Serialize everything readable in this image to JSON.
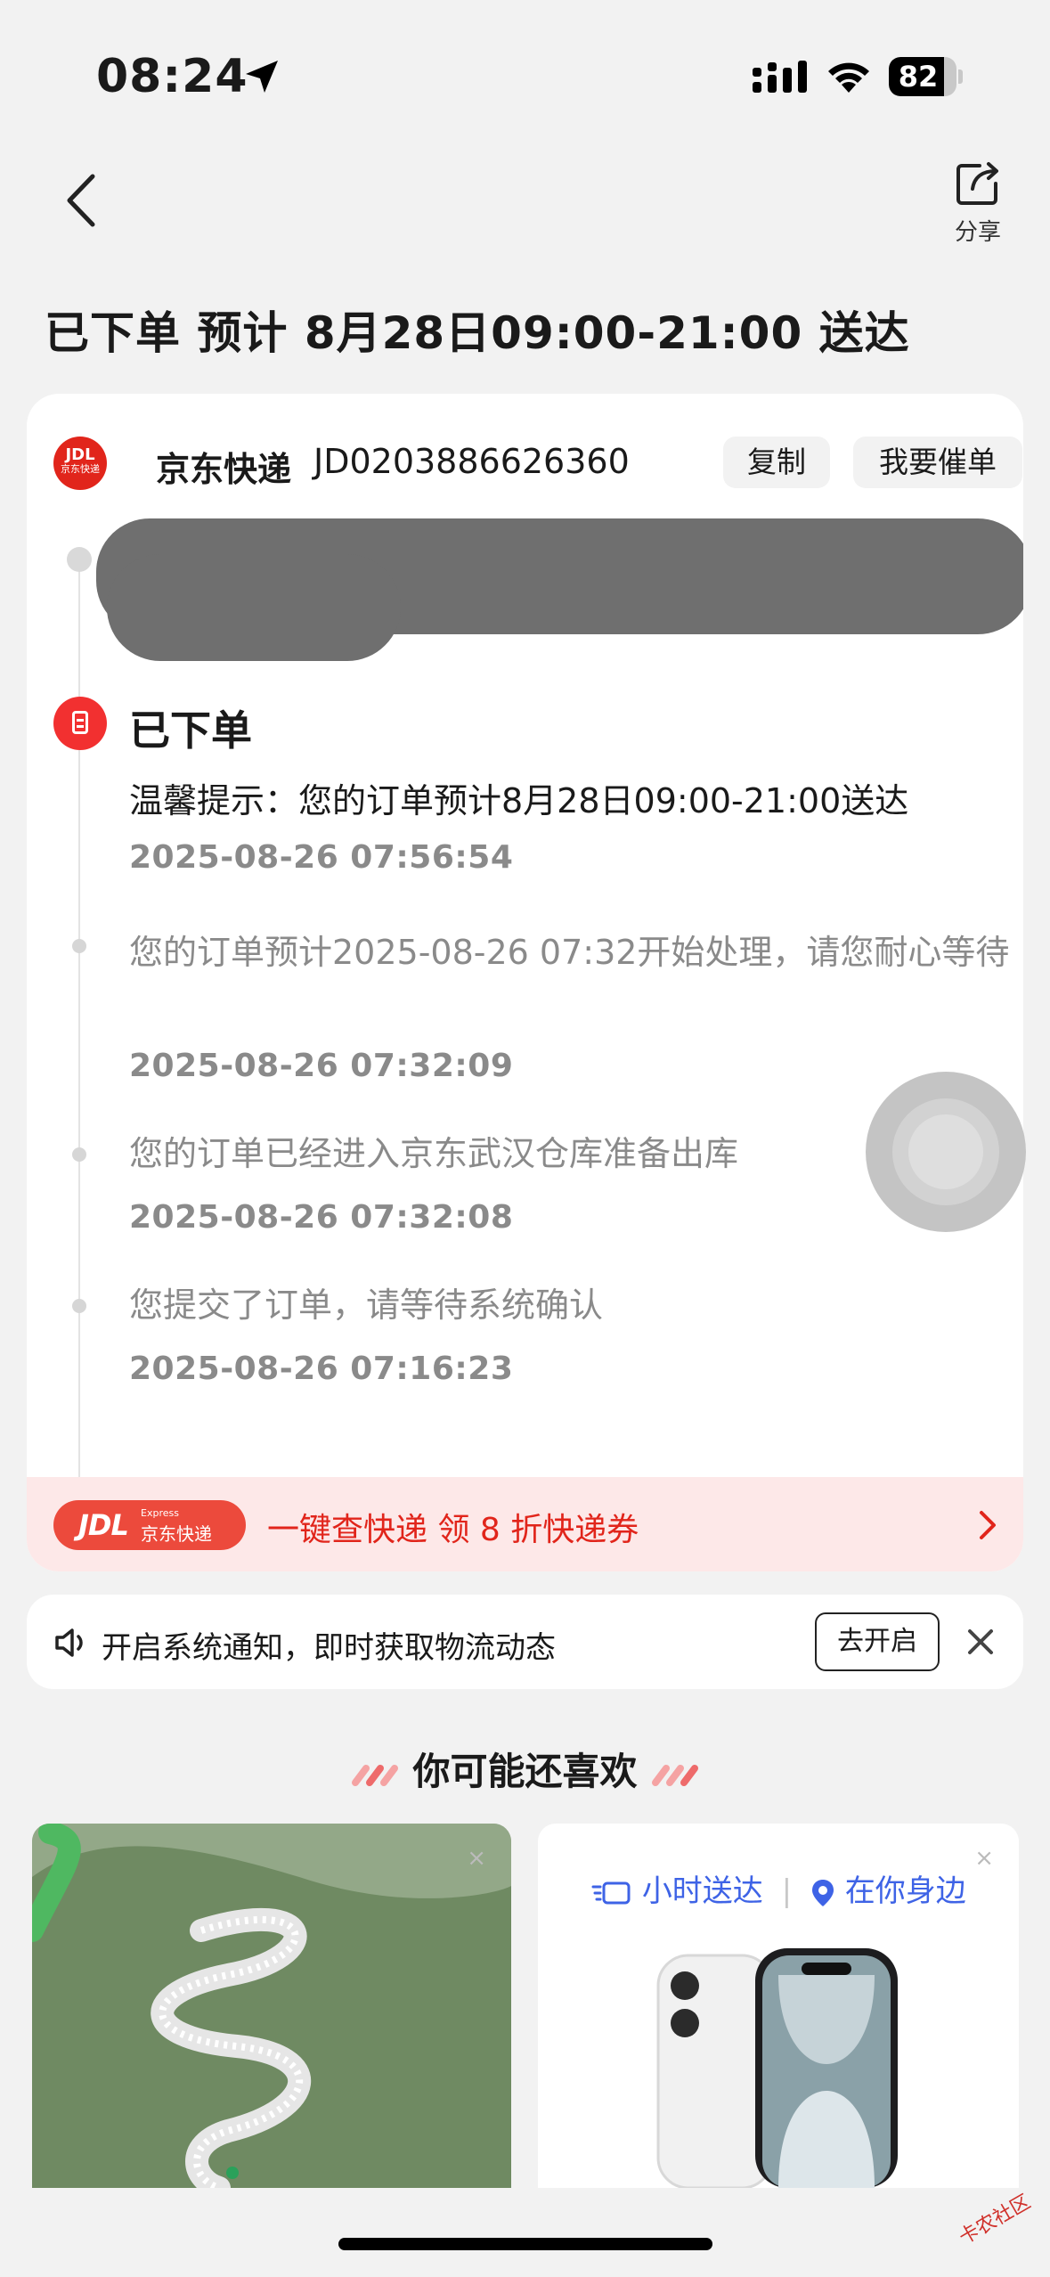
{
  "status_bar": {
    "time": "08:24",
    "battery": "82",
    "battery_level": 0.82
  },
  "nav": {
    "share_label": "分享"
  },
  "order_status": {
    "title": "已下单 预计 8月28日09:00-21:00 送达"
  },
  "carrier": {
    "logo_line1": "JDL",
    "logo_line2": "京东快递",
    "name": "京东快递",
    "tracking_number": "JD0203886626360",
    "copy_label": "复制",
    "urge_label": "我要催单"
  },
  "timeline": {
    "current": {
      "title": "已下单",
      "text": "温馨提示：您的订单预计8月28日09:00-21:00送达",
      "time": "2025-08-26 07:56:54"
    },
    "events": [
      {
        "text": "您的订单预计2025-08-26 07:32开始处理，请您耐心等待",
        "time": "2025-08-26 07:32:09"
      },
      {
        "text": "您的订单已经进入京东武汉仓库准备出库",
        "time": "2025-08-26 07:32:08"
      },
      {
        "text": "您提交了订单，请等待系统确认",
        "time": "2025-08-26 07:16:23"
      }
    ]
  },
  "promo_banner": {
    "badge_main": "JDL",
    "badge_small": "Express",
    "badge_cn": "京东快递",
    "text": "一键查快递  领 8 折快递券"
  },
  "notification": {
    "text": "开启系统通知，即时获取物流动态",
    "button": "去开启"
  },
  "recommendations": {
    "title": "你可能还喜欢",
    "right_tag_1": "小时送达",
    "right_tag_2": "在你身边",
    "close_glyph": "×"
  },
  "watermark": "卡农社区"
}
